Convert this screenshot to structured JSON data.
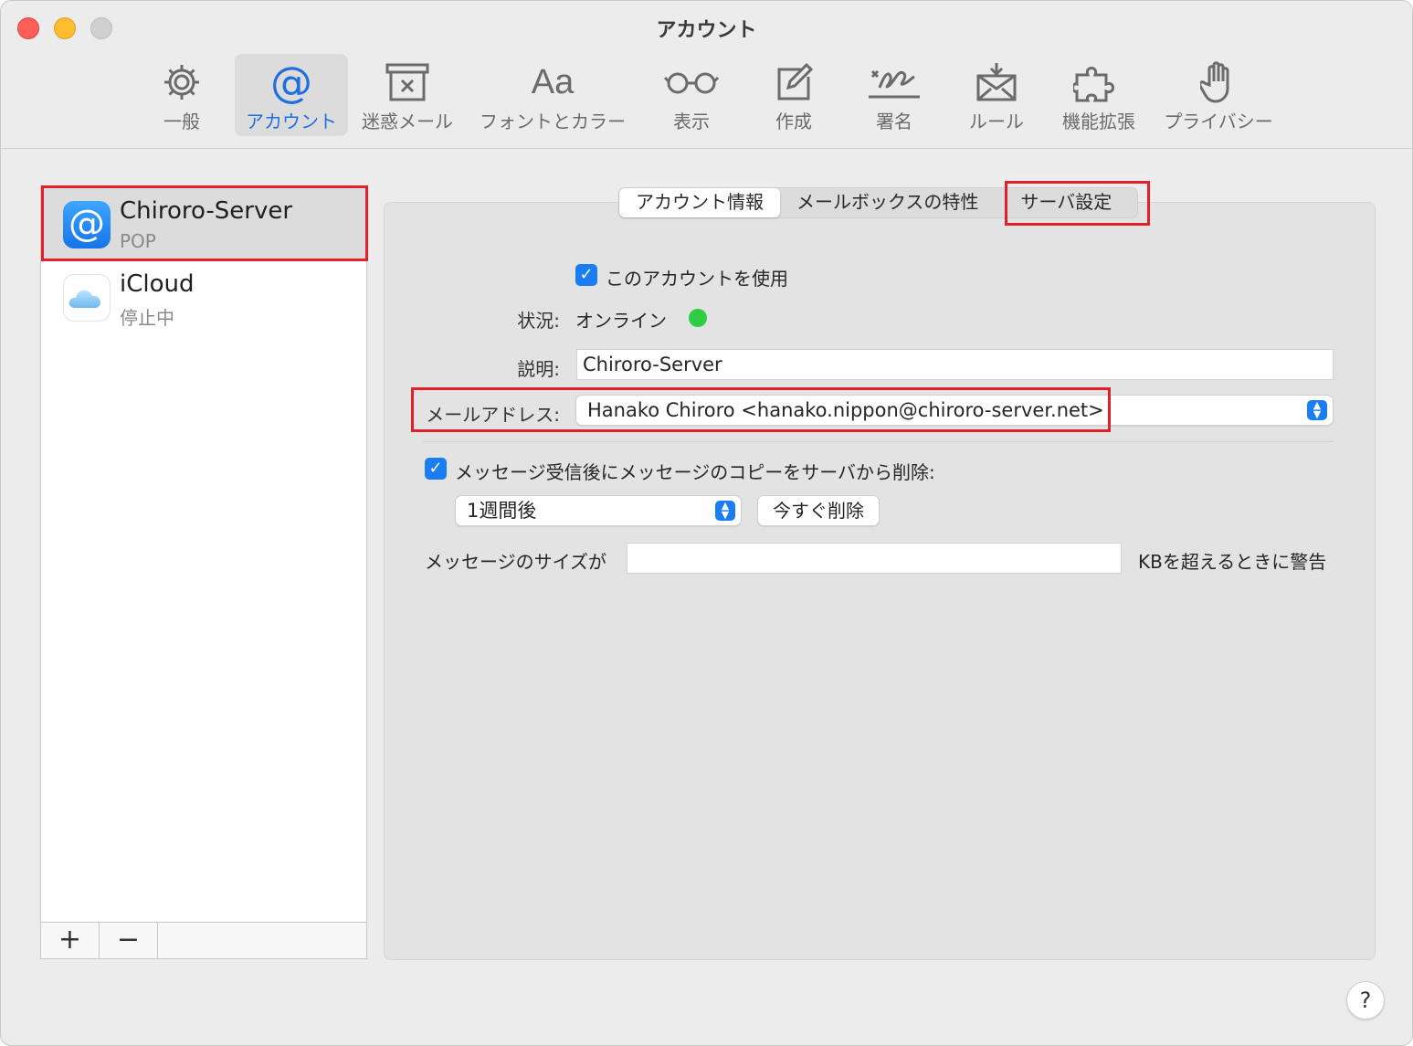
{
  "window": {
    "title": "アカウント"
  },
  "toolbar": {
    "items": [
      {
        "label": "一般",
        "icon": "gear-icon"
      },
      {
        "label": "アカウント",
        "icon": "at-icon",
        "active": true
      },
      {
        "label": "迷惑メール",
        "icon": "junk-mail-icon"
      },
      {
        "label": "フォントとカラー",
        "icon": "font-icon",
        "glyph": "Aa"
      },
      {
        "label": "表示",
        "icon": "glasses-icon"
      },
      {
        "label": "作成",
        "icon": "compose-icon"
      },
      {
        "label": "署名",
        "icon": "signature-icon"
      },
      {
        "label": "ルール",
        "icon": "rules-icon"
      },
      {
        "label": "機能拡張",
        "icon": "puzzle-icon"
      },
      {
        "label": "プライバシー",
        "icon": "hand-icon"
      }
    ]
  },
  "sidebar": {
    "accounts": [
      {
        "name": "Chiroro-Server",
        "type": "POP",
        "icon": "at-icon",
        "selected": true
      },
      {
        "name": "iCloud",
        "type": "停止中",
        "icon": "cloud-icon"
      }
    ],
    "add_label": "+",
    "remove_label": "−"
  },
  "tabs": {
    "items": [
      "アカウント情報",
      "メールボックスの特性",
      "サーバ設定"
    ],
    "active_index": 0
  },
  "form": {
    "enable_account_label": "このアカウントを使用",
    "status_label": "状況:",
    "status_value": "オンライン",
    "status_color": "#2fcc43",
    "description_label": "説明:",
    "description_value": "Chiroro-Server",
    "email_label": "メールアドレス:",
    "email_value": "Hanako Chiroro <hanako.nippon@chiroro-server.net>",
    "delete_copy_label": "メッセージ受信後にメッセージのコピーをサーバから削除:",
    "delete_period_value": "1週間後",
    "delete_now_label": "今すぐ削除",
    "size_warning_prefix": "メッセージのサイズが",
    "size_warning_value": "",
    "size_warning_suffix": "KBを超えるときに警告"
  },
  "help_label": "?",
  "colors": {
    "accent": "#1a7ef2",
    "highlight_box": "#e0202a"
  }
}
